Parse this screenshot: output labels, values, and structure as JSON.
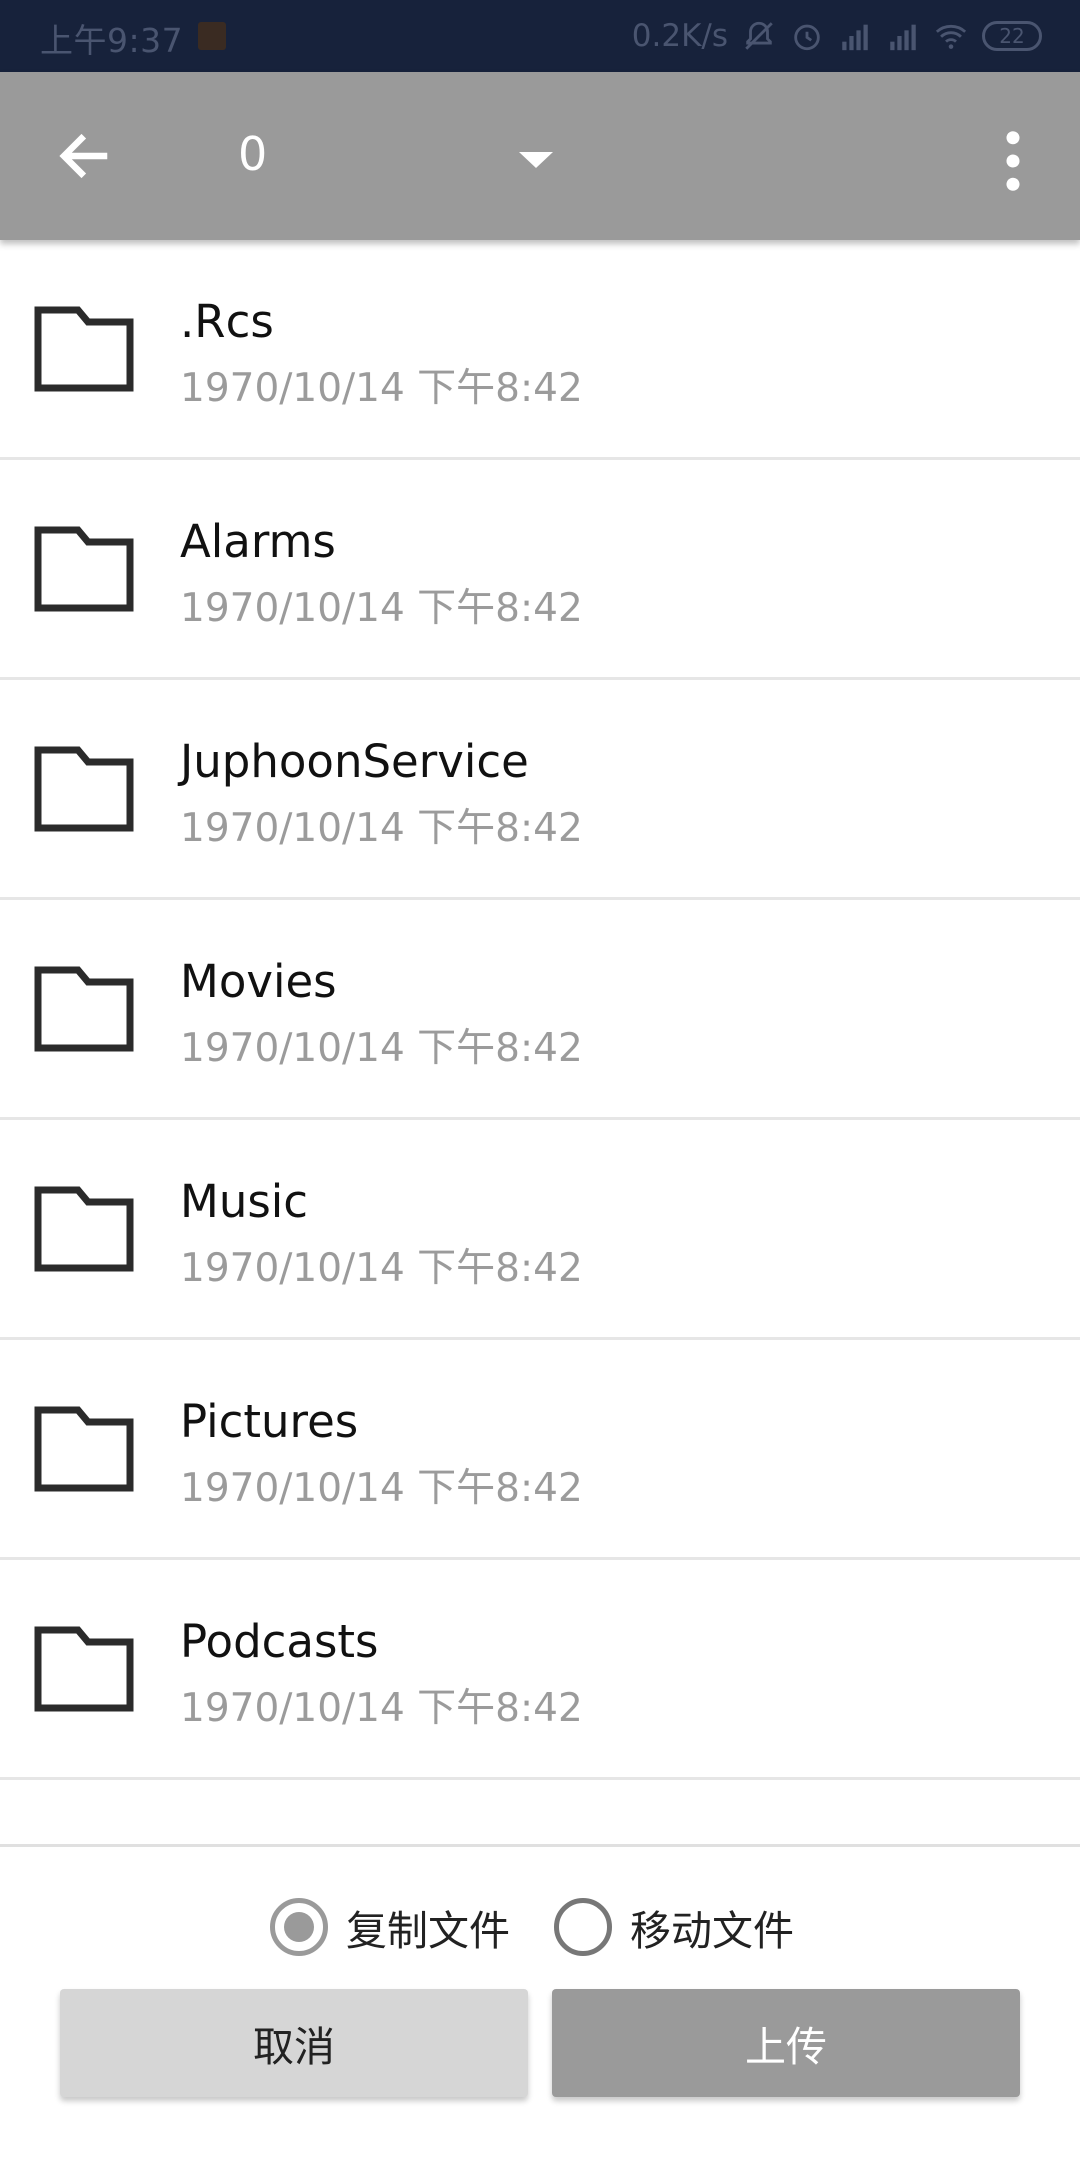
{
  "status_bar": {
    "time": "上午9:37",
    "net_speed": "0.2K/s",
    "battery": "22",
    "icons": [
      "mute-icon",
      "alarm-icon",
      "hd-signal-icon",
      "hd-signal-icon",
      "wifi-icon",
      "battery-icon"
    ]
  },
  "toolbar": {
    "path": "0",
    "icons": [
      "back-arrow-icon",
      "dropdown-icon",
      "more-vert-icon"
    ]
  },
  "files": [
    {
      "name": ".Rcs",
      "date": "1970/10/14 下午8:42"
    },
    {
      "name": "Alarms",
      "date": "1970/10/14 下午8:42"
    },
    {
      "name": "JuphoonService",
      "date": "1970/10/14 下午8:42"
    },
    {
      "name": "Movies",
      "date": "1970/10/14 下午8:42"
    },
    {
      "name": "Music",
      "date": "1970/10/14 下午8:42"
    },
    {
      "name": "Pictures",
      "date": "1970/10/14 下午8:42"
    },
    {
      "name": "Podcasts",
      "date": "1970/10/14 下午8:42"
    }
  ],
  "options": {
    "copy_label": "复制文件",
    "move_label": "移动文件",
    "selected": "copy"
  },
  "actions": {
    "cancel_label": "取消",
    "upload_label": "上传"
  },
  "colors": {
    "status_bar": "#17223b",
    "toolbar": "#9a9a9a",
    "cancel_button": "#d6d6d6",
    "upload_button": "#9a9a9a",
    "date_text": "#9b9b9b"
  }
}
